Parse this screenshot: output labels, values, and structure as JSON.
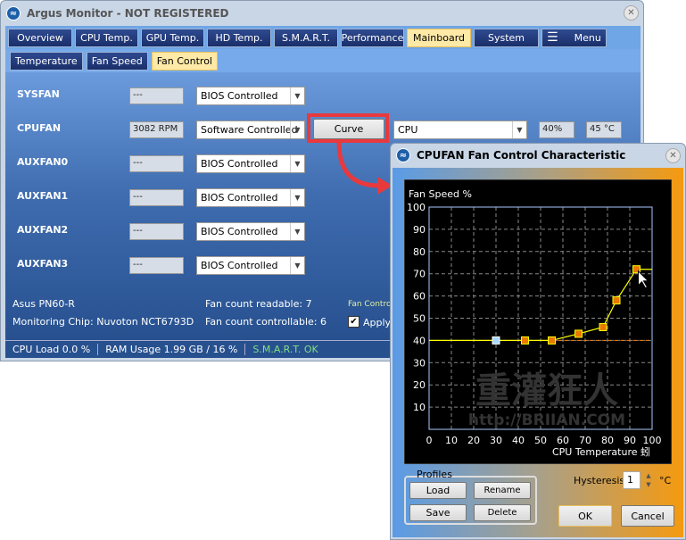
{
  "main": {
    "title": "Argus Monitor - NOT REGISTERED",
    "tabs": [
      {
        "label": "Overview"
      },
      {
        "label": "CPU Temp."
      },
      {
        "label": "GPU Temp."
      },
      {
        "label": "HD Temp."
      },
      {
        "label": "S.M.A.R.T."
      },
      {
        "label": "Performance"
      },
      {
        "label": "Mainboard",
        "active": true
      },
      {
        "label": "System"
      },
      {
        "label": "Menu"
      }
    ],
    "subtabs": [
      {
        "label": "Temperature"
      },
      {
        "label": "Fan Speed"
      },
      {
        "label": "Fan Control",
        "active": true
      }
    ],
    "fans": [
      {
        "name": "SYSFAN",
        "value": "---",
        "mode": "BIOS Controlled"
      },
      {
        "name": "CPUFAN",
        "value": "3082 RPM",
        "mode": "Software Controlled"
      },
      {
        "name": "AUXFAN0",
        "value": "---",
        "mode": "BIOS Controlled"
      },
      {
        "name": "AUXFAN1",
        "value": "---",
        "mode": "BIOS Controlled"
      },
      {
        "name": "AUXFAN2",
        "value": "---",
        "mode": "BIOS Controlled"
      },
      {
        "name": "AUXFAN3",
        "value": "---",
        "mode": "BIOS Controlled"
      }
    ],
    "curve_label": "Curve",
    "source": "CPU",
    "percent": "40%",
    "temp": "45 °C",
    "board": "Asus PN60-R",
    "chip": "Monitoring Chip: Nuvoton NCT6793D",
    "readable": "Fan count readable: 7",
    "controllable": "Fan count controllable: 6",
    "fan_control_label": "Fan Contro",
    "apply_label": "Apply",
    "status": {
      "cpu": "CPU Load 0.0 %",
      "ram": "RAM Usage 1.99 GB / 16 %",
      "smart": "S.M.A.R.T. OK"
    }
  },
  "dialog": {
    "title": "CPUFAN Fan Control Characteristic",
    "profiles_label": "Profiles",
    "load": "Load",
    "rename": "Rename",
    "save": "Save",
    "delete": "Delete",
    "hysteresis_label": "Hysteresis",
    "hysteresis_value": "1",
    "hysteresis_unit": "°C",
    "ok": "OK",
    "cancel": "Cancel",
    "watermark": "重灌狂人",
    "watermark_url": "http://BRIIAN.COM"
  },
  "chart_data": {
    "type": "line",
    "ylabel": "Fan Speed %",
    "xlabel": "CPU Temperature 蚓",
    "xlim": [
      0,
      100
    ],
    "ylim": [
      0,
      100
    ],
    "xticks": [
      0,
      10,
      20,
      30,
      40,
      50,
      60,
      70,
      80,
      90,
      100
    ],
    "yticks": [
      10,
      20,
      30,
      40,
      50,
      60,
      70,
      80,
      90,
      100
    ],
    "grid": true,
    "points": [
      [
        30,
        40
      ],
      [
        43,
        40
      ],
      [
        55,
        40
      ],
      [
        67,
        43
      ],
      [
        78,
        46
      ],
      [
        84,
        58
      ],
      [
        93,
        72
      ]
    ],
    "current_point": [
      30,
      40
    ],
    "reference_level": 40,
    "colors": {
      "line": "#ffff00",
      "point": "#e87a00",
      "current": "#a8d8ff",
      "reference": "#ff7a00",
      "grid": "#888888"
    }
  },
  "colors": {
    "highlight": "#e8393d",
    "active_tab": "#ffe9a6"
  }
}
